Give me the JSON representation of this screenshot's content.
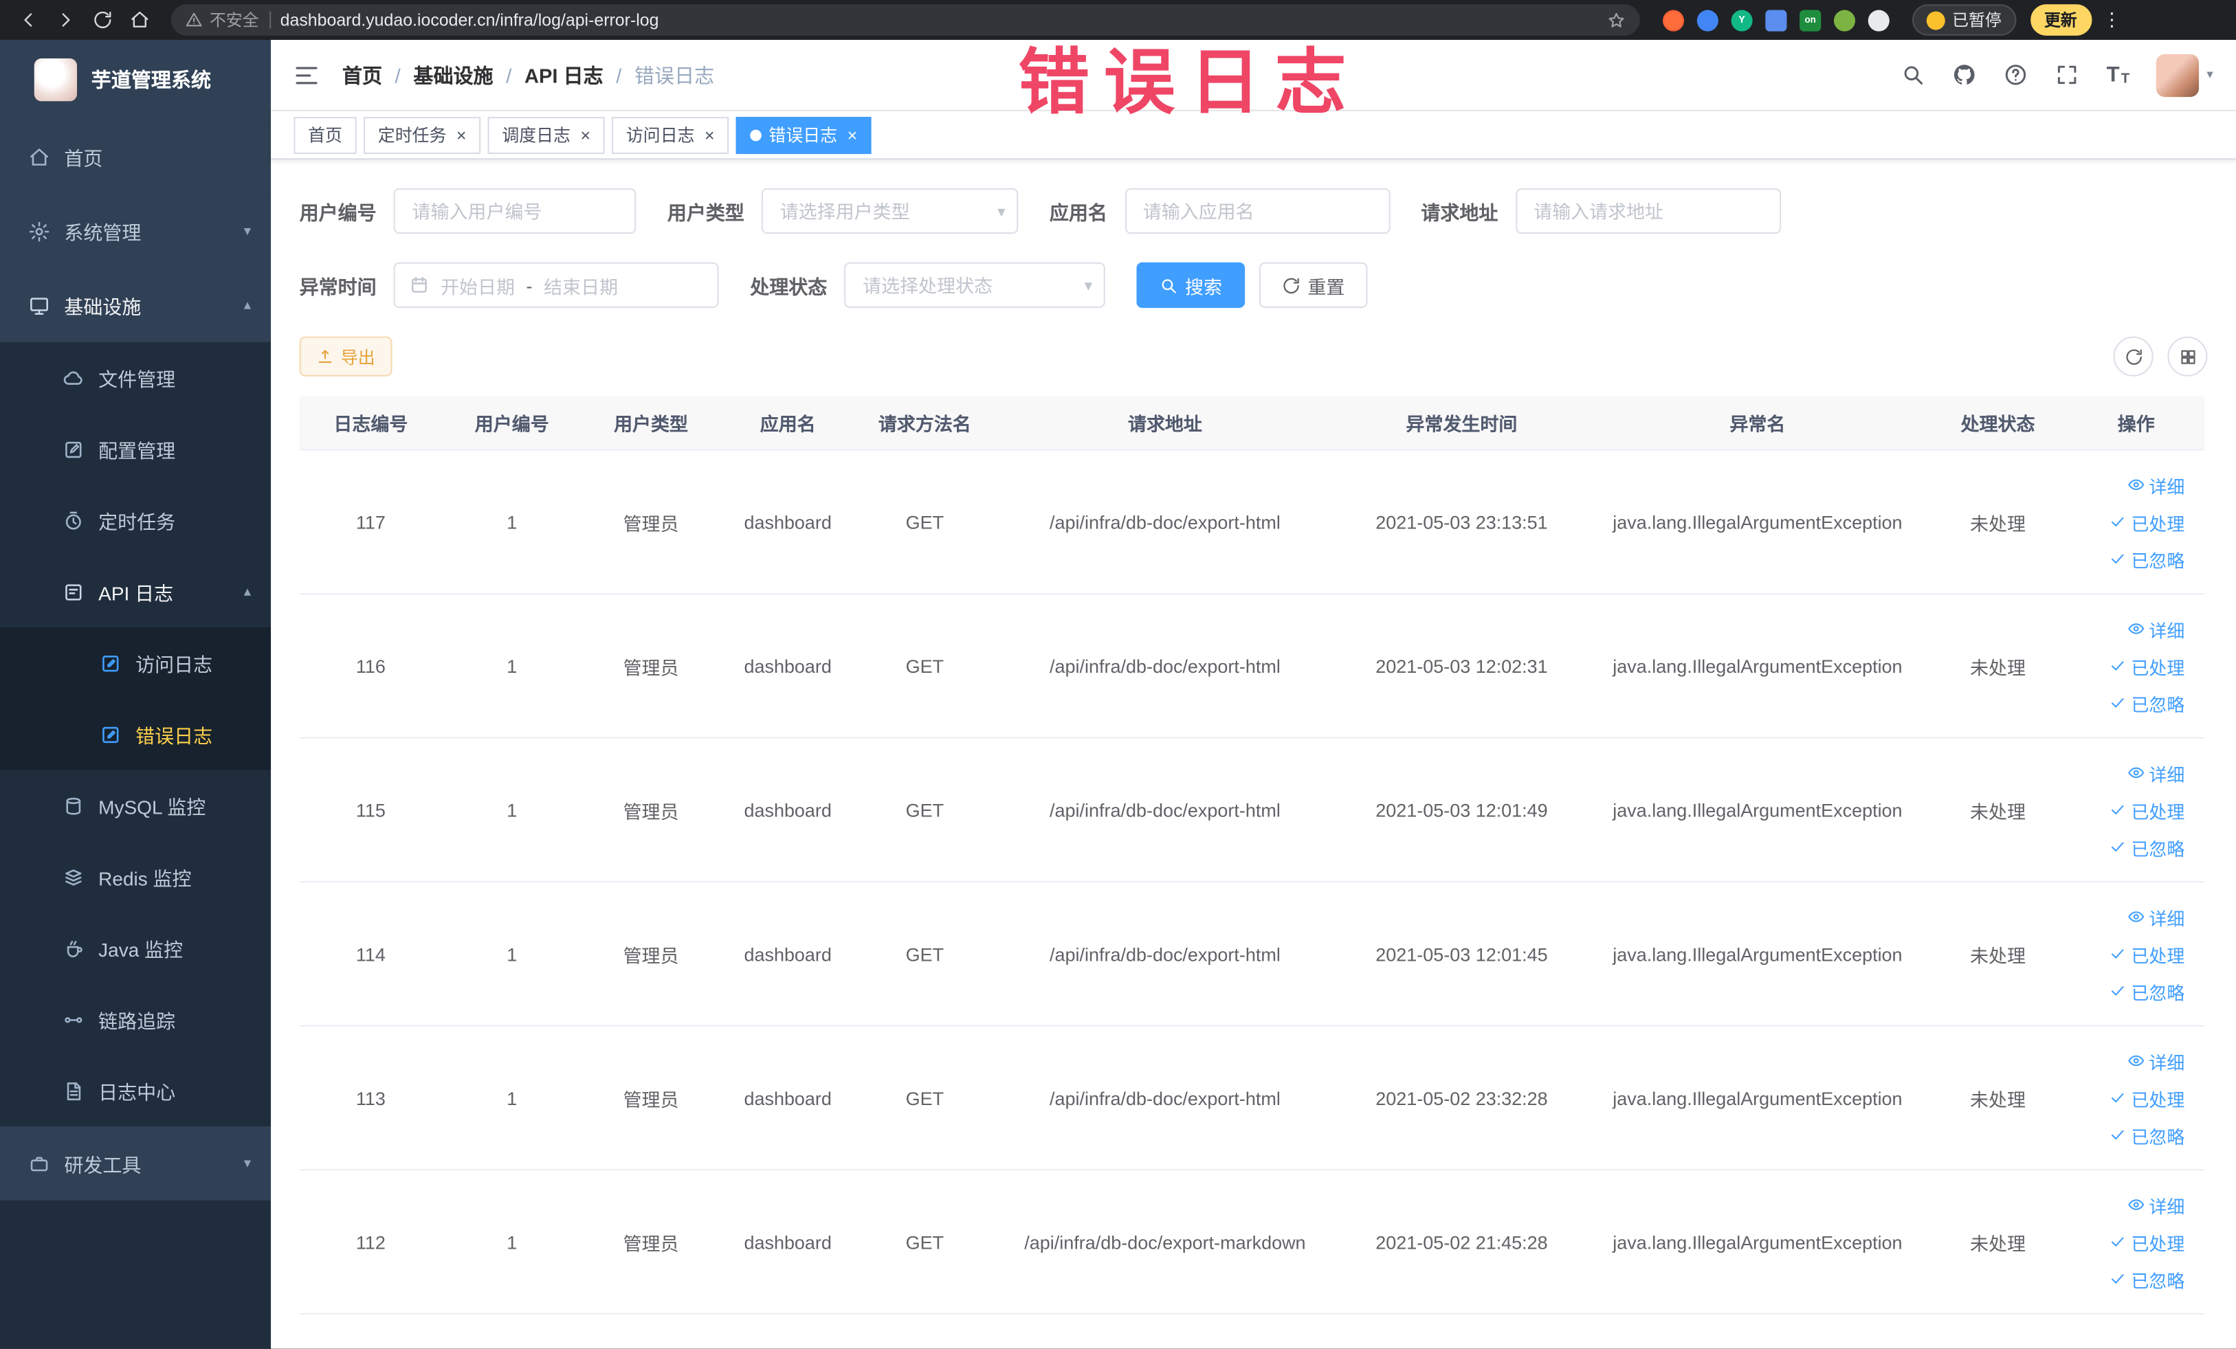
{
  "browser": {
    "security_label": "不安全",
    "url": "dashboard.yudao.iocoder.cn/infra/log/api-error-log",
    "paused_pill": "已暂停",
    "update_pill": "更新",
    "ext_on_badge": "on"
  },
  "annotation": {
    "text": "错误日志",
    "color": "#ef4666"
  },
  "sidebar": {
    "logo_title": "芋道管理系统",
    "items": [
      {
        "label": "首页",
        "icon": "home-icon"
      },
      {
        "label": "系统管理",
        "icon": "gear-icon",
        "state": "collapsed"
      },
      {
        "label": "基础设施",
        "icon": "infra-icon",
        "state": "expanded",
        "children": [
          {
            "label": "文件管理",
            "icon": "cloud-icon"
          },
          {
            "label": "配置管理",
            "icon": "config-icon"
          },
          {
            "label": "定时任务",
            "icon": "timer-icon"
          },
          {
            "label": "API 日志",
            "icon": "api-log-icon",
            "state": "expanded",
            "children": [
              {
                "label": "访问日志",
                "icon": "access-log-icon",
                "active": false
              },
              {
                "label": "错误日志",
                "icon": "error-log-icon",
                "active": true
              }
            ]
          },
          {
            "label": "MySQL 监控",
            "icon": "mysql-icon"
          },
          {
            "label": "Redis 监控",
            "icon": "redis-icon"
          },
          {
            "label": "Java 监控",
            "icon": "java-icon"
          },
          {
            "label": "链路追踪",
            "icon": "trace-icon"
          },
          {
            "label": "日志中心",
            "icon": "log-center-icon"
          }
        ]
      },
      {
        "label": "研发工具",
        "icon": "tools-icon",
        "state": "collapsed"
      }
    ]
  },
  "header": {
    "breadcrumb": [
      "首页",
      "基础设施",
      "API 日志",
      "错误日志"
    ]
  },
  "tabs": [
    {
      "label": "首页",
      "closable": false,
      "active": false
    },
    {
      "label": "定时任务",
      "closable": true,
      "active": false
    },
    {
      "label": "调度日志",
      "closable": true,
      "active": false
    },
    {
      "label": "访问日志",
      "closable": true,
      "active": false
    },
    {
      "label": "错误日志",
      "closable": true,
      "active": true
    }
  ],
  "filters": {
    "user_id": {
      "label": "用户编号",
      "placeholder": "请输入用户编号"
    },
    "user_type": {
      "label": "用户类型",
      "placeholder": "请选择用户类型"
    },
    "app_name": {
      "label": "应用名",
      "placeholder": "请输入应用名"
    },
    "request_url": {
      "label": "请求地址",
      "placeholder": "请输入请求地址"
    },
    "exception_time": {
      "label": "异常时间",
      "start_placeholder": "开始日期",
      "separator": "-",
      "end_placeholder": "结束日期"
    },
    "process_status": {
      "label": "处理状态",
      "placeholder": "请选择处理状态"
    },
    "search_button": "搜索",
    "reset_button": "重置"
  },
  "toolbar": {
    "export_button": "导出"
  },
  "table": {
    "columns": [
      "日志编号",
      "用户编号",
      "用户类型",
      "应用名",
      "请求方法名",
      "请求地址",
      "异常发生时间",
      "异常名",
      "处理状态",
      "操作"
    ],
    "actions": [
      "详细",
      "已处理",
      "已忽略"
    ],
    "rows": [
      {
        "id": "117",
        "user_id": "1",
        "user_type": "管理员",
        "app": "dashboard",
        "method": "GET",
        "url": "/api/infra/db-doc/export-html",
        "time": "2021-05-03 23:13:51",
        "exception": "java.lang.IllegalArgumentException",
        "status": "未处理"
      },
      {
        "id": "116",
        "user_id": "1",
        "user_type": "管理员",
        "app": "dashboard",
        "method": "GET",
        "url": "/api/infra/db-doc/export-html",
        "time": "2021-05-03 12:02:31",
        "exception": "java.lang.IllegalArgumentException",
        "status": "未处理"
      },
      {
        "id": "115",
        "user_id": "1",
        "user_type": "管理员",
        "app": "dashboard",
        "method": "GET",
        "url": "/api/infra/db-doc/export-html",
        "time": "2021-05-03 12:01:49",
        "exception": "java.lang.IllegalArgumentException",
        "status": "未处理"
      },
      {
        "id": "114",
        "user_id": "1",
        "user_type": "管理员",
        "app": "dashboard",
        "method": "GET",
        "url": "/api/infra/db-doc/export-html",
        "time": "2021-05-03 12:01:45",
        "exception": "java.lang.IllegalArgumentException",
        "status": "未处理"
      },
      {
        "id": "113",
        "user_id": "1",
        "user_type": "管理员",
        "app": "dashboard",
        "method": "GET",
        "url": "/api/infra/db-doc/export-html",
        "time": "2021-05-02 23:32:28",
        "exception": "java.lang.IllegalArgumentException",
        "status": "未处理"
      },
      {
        "id": "112",
        "user_id": "1",
        "user_type": "管理员",
        "app": "dashboard",
        "method": "GET",
        "url": "/api/infra/db-doc/export-markdown",
        "time": "2021-05-02 21:45:28",
        "exception": "java.lang.IllegalArgumentException",
        "status": "未处理"
      }
    ]
  },
  "colors": {
    "primary": "#409eff",
    "sidebar_bg": "#304156",
    "submenu_bg": "#1f2d3d",
    "active_menu_text": "#ffd04b",
    "warning": "#e6a23c",
    "annotation": "#ef4666"
  }
}
